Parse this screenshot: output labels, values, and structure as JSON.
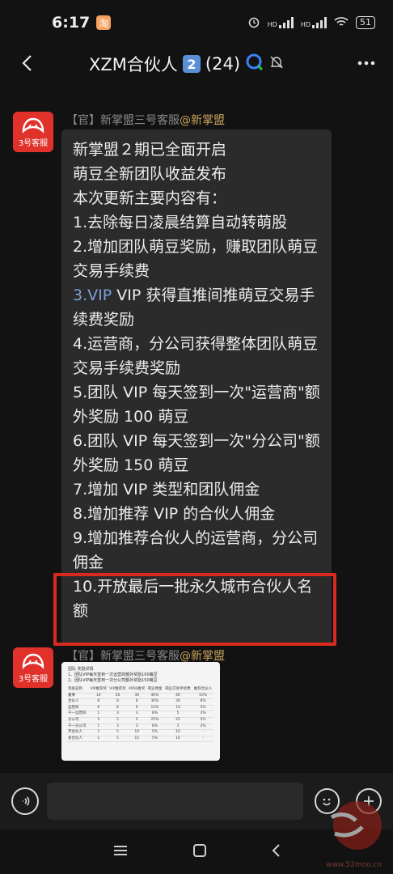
{
  "status": {
    "time": "6:17",
    "notif_icon": "taobao-icon",
    "hd1": "HD",
    "hd2": "HD",
    "battery": "51"
  },
  "header": {
    "title": "XZM合伙人",
    "badge": "2",
    "count": "(24)"
  },
  "messages": [
    {
      "sender_prefix": "【官】新掌盟三号客服",
      "sender_at": "@新掌盟",
      "avatar_label": "3号客服",
      "lines": [
        "新掌盟２期已全面开启",
        "萌豆全新团队收益发布",
        "本次更新主要内容有：",
        "1.去除每日凌晨结算自动转萌股",
        "2.增加团队萌豆奖励，赚取团队萌豆交易手续费",
        "VIP 获得直推间推萌豆交易手续费奖励",
        "4.运营商，分公司获得整体团队萌豆交易手续费奖励",
        "5.团队 VIP 每天签到一次\"运营商\"额外奖励 100 萌豆",
        "6.团队 VIP 每天签到一次\"分公司\"额外奖励 150 萌豆",
        "7.增加 VIP 类型和团队佣金",
        "8.增加推荐 VIP 的合伙人佣金",
        "9.增加推荐合伙人的运营商，分公司佣金",
        "10.开放最后一批永久城市合伙人名额"
      ],
      "link_text": "3.VIP"
    },
    {
      "sender_prefix": "【官】新掌盟三号客服",
      "sender_at": "@新掌盟",
      "avatar_label": "3号客服",
      "image": {
        "title1": "团队 奖励详情",
        "title2": "1、团队VIP每天签到一次运营商额外奖励100萌豆",
        "title3": "2、团队VIP每天签到一次分公司额外奖励150萌豆",
        "headers": [
          "等级名称",
          "VIP推荐奖",
          "VIP推荐奖",
          "VIP间推奖",
          "萌豆佣金",
          "萌豆交易手续费",
          "推荐合伙人"
        ],
        "rows": [
          [
            "董事",
            "10",
            "20",
            "30",
            "40%",
            "40",
            "10%"
          ],
          [
            "合伙人",
            "8",
            "8",
            "8",
            "30%",
            "30",
            "8%"
          ],
          [
            "运营商",
            "6",
            "6",
            "6",
            "15%",
            "10",
            "5%"
          ],
          [
            "千一运营商",
            "1",
            "3",
            "3",
            "8%",
            "5",
            "3%"
          ],
          [
            "分公司",
            "5",
            "5",
            "5",
            "25%",
            "25",
            "5%"
          ],
          [
            "千一分公司",
            "1",
            "3",
            "3",
            "8%",
            "3",
            "3%"
          ],
          [
            "市合伙人",
            "1",
            "5",
            "10",
            "5%",
            "10",
            "-"
          ],
          [
            "省合伙人",
            "1",
            "5",
            "10",
            "5%",
            "10",
            "-"
          ]
        ]
      }
    }
  ],
  "input": {
    "placeholder": ""
  },
  "watermark": {
    "text": "www.52moo.cn"
  },
  "colors": {
    "background": "#121212",
    "bubble": "#2b2b2b",
    "highlight": "#d92a1f",
    "avatar": "#e0312b",
    "link": "#7f9fd6"
  }
}
